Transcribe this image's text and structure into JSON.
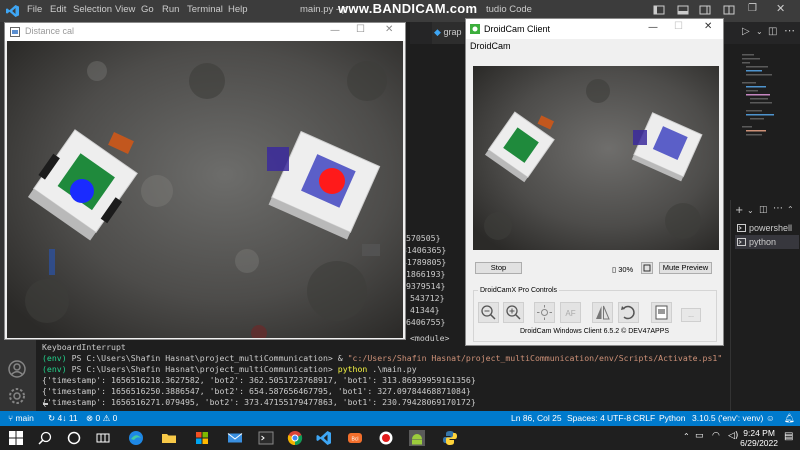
{
  "vscode": {
    "menu": [
      "File",
      "Edit",
      "Selection",
      "View",
      "Go",
      "Run",
      "Terminal",
      "Help"
    ],
    "title_prefix": "main.py - p",
    "title_suffix": "tudio Code",
    "watermark": "www.BANDICAM.com",
    "tab_fragment": "grap",
    "terminal": {
      "right_fragments": [
        "570505}",
        "31406365}",
        "41789805}",
        "1866193}",
        "9379514}",
        "543712}",
        "41344}",
        "6406755}",
        "<module>"
      ],
      "lines": [
        {
          "parts": [
            {
              "t": "KeyboardInterrupt",
              "c": ""
            }
          ]
        },
        {
          "parts": [
            {
              "t": "(env) ",
              "c": "g"
            },
            {
              "t": "PS C:\\Users\\Shafin Hasnat\\project_multiCommunication> ",
              "c": ""
            },
            {
              "t": "& ",
              "c": ""
            },
            {
              "t": "\"c:/Users/Shafin Hasnat/project_multiCommunication/env/Scripts/Activate.ps1\"",
              "c": "o"
            }
          ]
        },
        {
          "parts": [
            {
              "t": "(env) ",
              "c": "g"
            },
            {
              "t": "PS C:\\Users\\Shafin Hasnat\\project_multiCommunication> ",
              "c": ""
            },
            {
              "t": "python",
              "c": "y"
            },
            {
              "t": " .\\main.py",
              "c": ""
            }
          ]
        },
        {
          "parts": [
            {
              "t": "{'timestamp': 1656516218.3627582, 'bot2': 362.5051723768917, 'bot1': 313.86939959161356}",
              "c": ""
            }
          ]
        },
        {
          "parts": [
            {
              "t": "{'timestamp': 1656516250.3886547, 'bot2': 654.587656467795, 'bot1': 327.09784468871084}",
              "c": ""
            }
          ]
        },
        {
          "parts": [
            {
              "t": "{'timestamp': 1656516271.079495, 'bot2': 373.47155179477863, 'bot1': 230.79428069170172}",
              "c": ""
            }
          ]
        }
      ],
      "shells": [
        "powershell",
        "python"
      ]
    }
  },
  "statusbar": {
    "branch": "main",
    "sync": "4↓ 11",
    "errors": "0",
    "warnings": "0",
    "position": "Ln 86, Col 25",
    "spaces": "Spaces: 4",
    "encoding": "UTF-8",
    "eol": "CRLF",
    "language": "Python",
    "interpreter": "3.10.5 ('env': venv)"
  },
  "distance_window": {
    "title": "Distance cal"
  },
  "droidcam": {
    "title": "DroidCam Client",
    "menu": "DroidCam",
    "stop": "Stop",
    "battery": "30%",
    "mute_preview": "Mute Preview",
    "pro_controls": "DroidCamX Pro Controls",
    "version": "DroidCam Windows Client 6.5.2 © DEV47APPS"
  },
  "taskbar": {
    "time": "9:24 PM",
    "date": "6/29/2022"
  },
  "colors": {
    "vscode_blue": "#007acc",
    "bot_blue": "#1a2bff",
    "bot_red": "#ff1a1a",
    "green_marker": "#1f8a3c"
  }
}
